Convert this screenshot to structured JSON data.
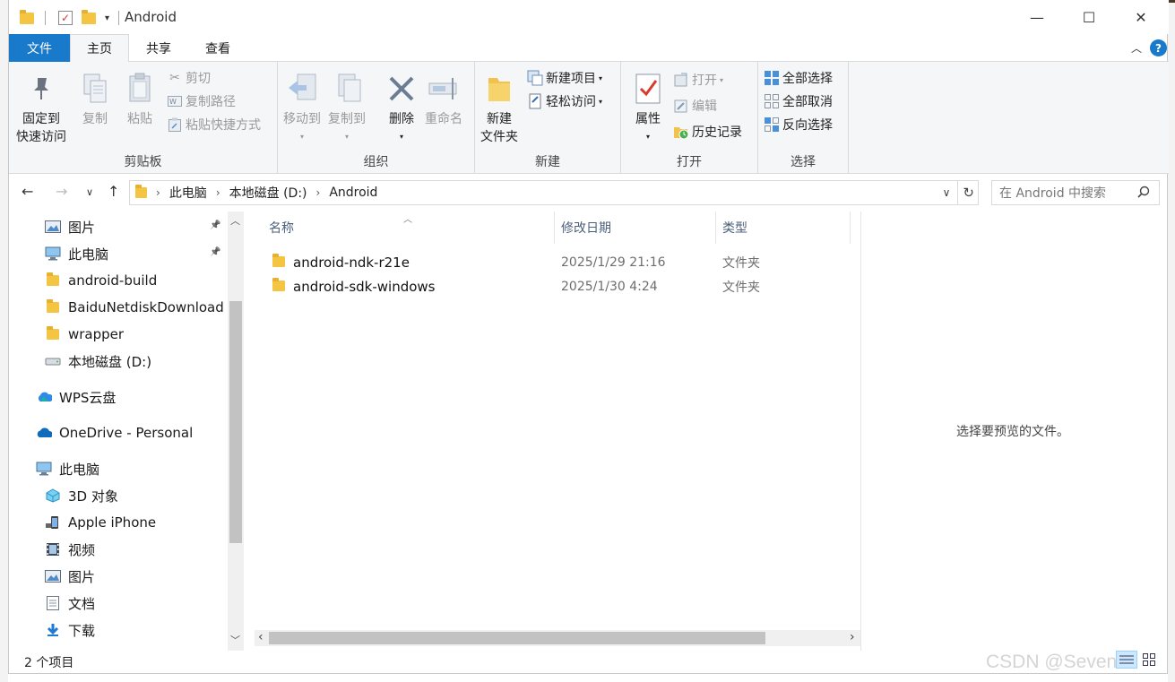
{
  "window": {
    "title": "Android",
    "minimize_glyph": "—",
    "maximize_glyph": "☐",
    "close_glyph": "✕"
  },
  "ribbon_tabs": {
    "file": "文件",
    "home": "主页",
    "share": "共享",
    "view": "查看",
    "help": "?"
  },
  "ribbon": {
    "clipboard": {
      "label": "剪贴板",
      "pin_quick": "固定到\n快速访问",
      "pin_quick_l1": "固定到",
      "pin_quick_l2": "快速访问",
      "copy": "复制",
      "paste": "粘贴",
      "cut": "剪切",
      "copy_path": "复制路径",
      "paste_shortcut": "粘贴快捷方式"
    },
    "organize": {
      "label": "组织",
      "move_to": "移动到",
      "copy_to": "复制到",
      "delete": "删除",
      "rename": "重命名"
    },
    "new": {
      "label": "新建",
      "new_folder_l1": "新建",
      "new_folder_l2": "文件夹",
      "new_item": "新建项目",
      "easy_access": "轻松访问"
    },
    "open": {
      "label": "打开",
      "properties": "属性",
      "open": "打开",
      "edit": "编辑",
      "history": "历史记录"
    },
    "select": {
      "label": "选择",
      "select_all": "全部选择",
      "select_none": "全部取消",
      "invert": "反向选择"
    }
  },
  "address": {
    "crumbs": [
      "此电脑",
      "本地磁盘 (D:)",
      "Android"
    ],
    "search_placeholder": "在 Android 中搜索"
  },
  "nav_pane": {
    "items": [
      {
        "label": "图片",
        "icon": "pictures-icon",
        "pinned": true
      },
      {
        "label": "此电脑",
        "icon": "computer-icon",
        "pinned": true
      },
      {
        "label": "android-build",
        "icon": "folder-icon",
        "pinned": false
      },
      {
        "label": "BaiduNetdiskDownload",
        "icon": "folder-icon",
        "pinned": false
      },
      {
        "label": "wrapper",
        "icon": "folder-icon",
        "pinned": false
      },
      {
        "label": "本地磁盘 (D:)",
        "icon": "drive-icon",
        "pinned": false
      },
      {
        "label": "WPS云盘",
        "icon": "cloud-icon",
        "pinned": false
      },
      {
        "label": "OneDrive - Personal",
        "icon": "onedrive-icon",
        "pinned": false
      },
      {
        "label": "此电脑",
        "icon": "computer-icon",
        "pinned": false
      },
      {
        "label": "3D 对象",
        "icon": "3d-objects-icon",
        "pinned": false
      },
      {
        "label": "Apple iPhone",
        "icon": "phone-icon",
        "pinned": false
      },
      {
        "label": "视频",
        "icon": "video-icon",
        "pinned": false
      },
      {
        "label": "图片",
        "icon": "pictures-icon",
        "pinned": false
      },
      {
        "label": "文档",
        "icon": "documents-icon",
        "pinned": false
      },
      {
        "label": "下载",
        "icon": "download-icon",
        "pinned": false
      }
    ]
  },
  "file_list": {
    "columns": [
      "名称",
      "修改日期",
      "类型"
    ],
    "rows": [
      {
        "name": "android-ndk-r21e",
        "date": "2025/1/29 21:16",
        "type": "文件夹"
      },
      {
        "name": "android-sdk-windows",
        "date": "2025/1/30 4:24",
        "type": "文件夹"
      }
    ]
  },
  "preview": {
    "message": "选择要预览的文件。"
  },
  "status": {
    "count": "2 个项目"
  },
  "watermark": "CSDN @Seven"
}
